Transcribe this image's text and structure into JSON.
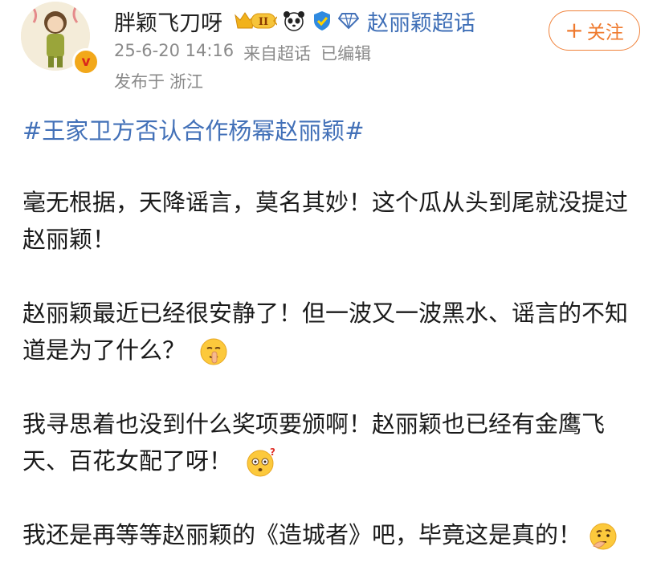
{
  "header": {
    "username": "胖颖飞刀呀",
    "member_level": "II",
    "super_topic": "赵丽颖超话",
    "meta": {
      "time": "25-6-20 14:16",
      "source": "来自超话",
      "edited": "已编辑"
    },
    "location": {
      "prefix": "发布于",
      "place": "浙江"
    },
    "follow": {
      "plus": "+",
      "label": "关注"
    },
    "verified_mark": "v"
  },
  "post": {
    "hashtag": "#王家卫方否认合作杨幂赵丽颖#",
    "paragraphs": [
      {
        "text": "毫无根据，天降谣言，莫名其妙！这个瓜从头到尾就没提过赵丽颖！",
        "emoji": null
      },
      {
        "text": "赵丽颖最近已经很安静了！但一波又一波黑水、谣言的不知道是为了什么？",
        "emoji": "shushing-face-emoji"
      },
      {
        "text": "我寻思着也没到什么奖项要颁啊！赵丽颖也已经有金鹰飞天、百花女配了呀！",
        "emoji": "confused-face-emoji"
      },
      {
        "text": "我还是再等等赵丽颖的《造城者》吧，毕竟这是真的！",
        "emoji": "thinking-face-emoji"
      }
    ]
  },
  "colors": {
    "link_blue": "#4371b8",
    "follow_orange": "#ef7a2e",
    "meta_gray": "#8a8a8a",
    "badge_gold": "#f2a81a"
  }
}
